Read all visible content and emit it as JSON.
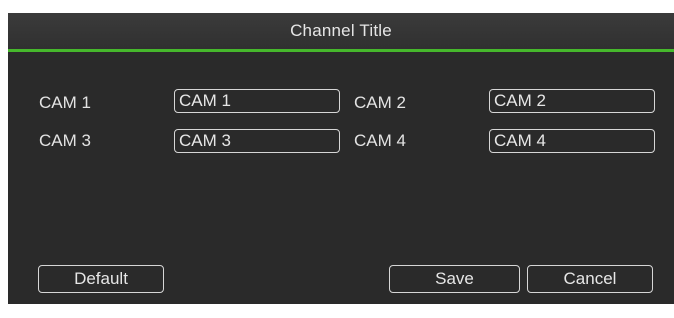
{
  "dialog": {
    "title": "Channel Title"
  },
  "channels": [
    {
      "label": "CAM 1",
      "value": "CAM 1"
    },
    {
      "label": "CAM 2",
      "value": "CAM 2"
    },
    {
      "label": "CAM 3",
      "value": "CAM 3"
    },
    {
      "label": "CAM 4",
      "value": "CAM 4"
    }
  ],
  "buttons": {
    "default_label": "Default",
    "save_label": "Save",
    "cancel_label": "Cancel"
  },
  "colors": {
    "accent": "#46b82c",
    "background": "#2a2a2a",
    "text": "#e6e6e6"
  }
}
